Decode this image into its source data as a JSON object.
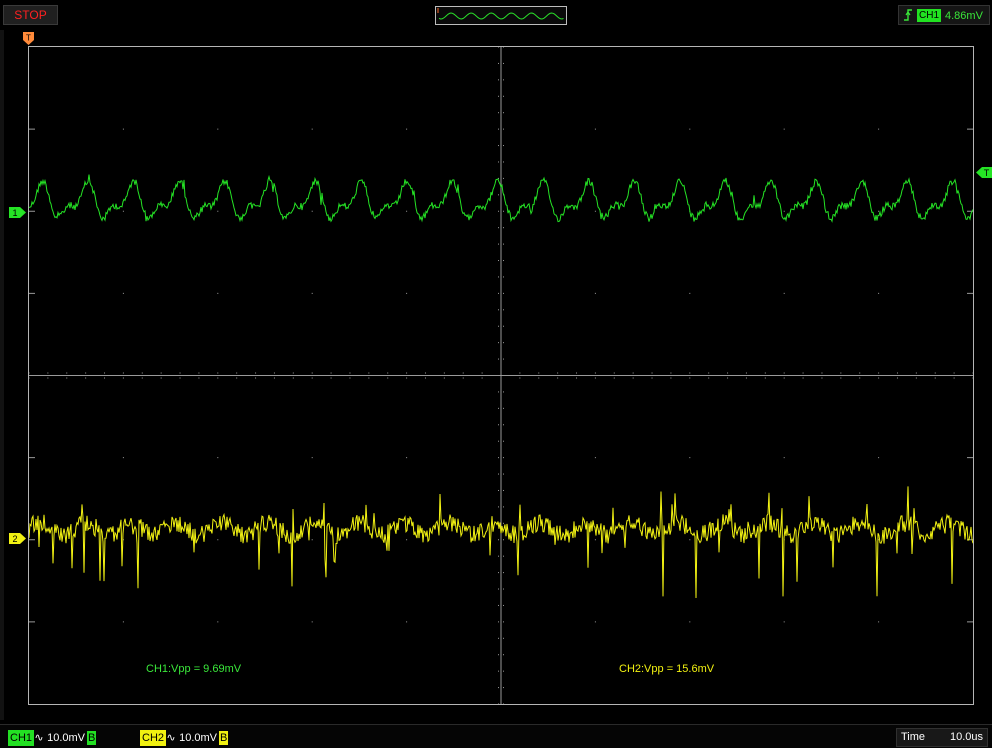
{
  "status": {
    "run_state": "STOP",
    "color": "#ff2020"
  },
  "trigger": {
    "source": "CH1",
    "level": "4.86mV",
    "edge_icon": "rising-edge-icon"
  },
  "markers": {
    "trigger_position": "T",
    "trigger_level": "T",
    "ch1_ground": "1",
    "ch2_ground": "2"
  },
  "colors": {
    "ch1": "#25e425",
    "ch2": "#f2f213",
    "grid": "#9a9a9a",
    "background": "#000000"
  },
  "measurements": {
    "ch1": "CH1:Vpp = 9.69mV",
    "ch2": "CH2:Vpp = 15.6mV"
  },
  "channels": [
    {
      "tag": "CH1",
      "coupling_icon": "ac-coupling-icon",
      "coupling_glyph": "∿",
      "scale": "10.0mV",
      "bw_limit": "B"
    },
    {
      "tag": "CH2",
      "coupling_icon": "ac-coupling-icon",
      "coupling_glyph": "∿",
      "scale": "10.0mV",
      "bw_limit": "B"
    }
  ],
  "timebase": {
    "label": "Time",
    "value": "10.0us"
  }
}
